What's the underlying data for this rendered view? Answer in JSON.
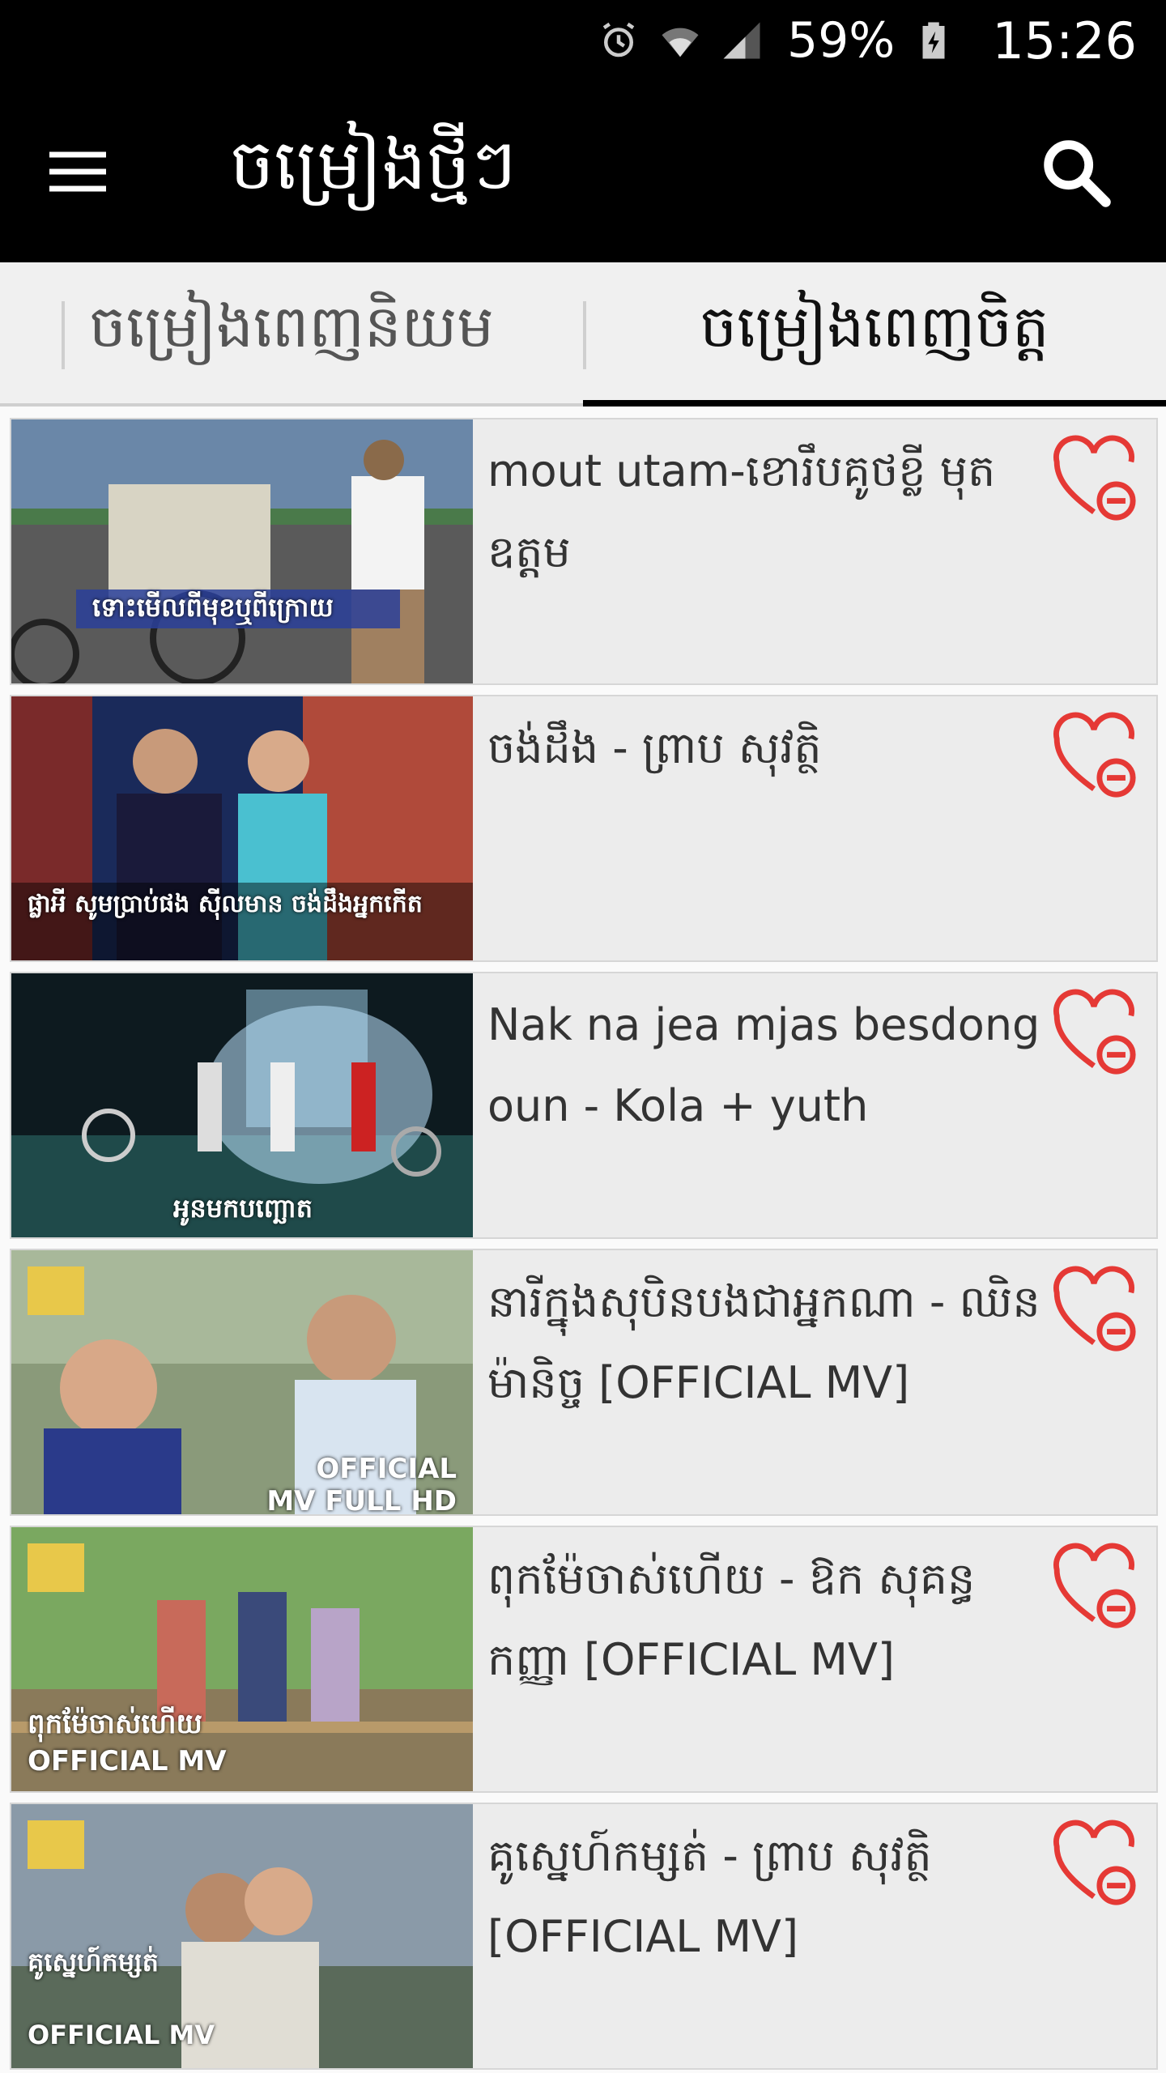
{
  "status_bar": {
    "icons": [
      "alarm-icon",
      "wifi-icon",
      "signal-icon",
      "battery-icon"
    ],
    "battery": "59%",
    "time": "15:26"
  },
  "app_bar": {
    "title": "ចម្រៀងថ្មីៗ",
    "menu_icon": "hamburger-menu-icon",
    "search_icon": "search-icon"
  },
  "tabs": [
    {
      "label": "ចម្រៀងពេញនិយម",
      "active": false
    },
    {
      "label": "ចម្រៀងពេញចិត្ត",
      "active": true
    }
  ],
  "songs": [
    {
      "title": "mout utam-ខោរឹបគូថខ្លី មុត ឧត្តម",
      "thumb_caption": "ទោះមើលពីមុខឬពីក្រោយ",
      "favorite_icon": "heart-minus-icon"
    },
    {
      "title": "ចង់ដឹង - ព្រាប សុវត្ថិ",
      "thumb_caption": "ផ្លាអី សូមប្រាប់ផង ស៊ីលមាន ចង់ដឹងអ្នកកើត",
      "favorite_icon": "heart-minus-icon"
    },
    {
      "title": "Nak na jea mjas besdong oun - Kola + yuth",
      "thumb_caption": "អូនមកបញ្ឆោត",
      "favorite_icon": "heart-minus-icon"
    },
    {
      "title": "នារីក្នុងសុបិនបងជាអ្នកណា - ឈិន ម៉ានិច្ច [OFFICIAL MV]",
      "thumb_caption": "OFFICIAL MV FULL HD",
      "favorite_icon": "heart-minus-icon"
    },
    {
      "title": "ពុកម៉ែចាស់ហើយ - ឱក សុគន្ធកញ្ញា [OFFICIAL MV]",
      "thumb_caption": "ពុកម៉ែចាស់ហើយ OFFICIAL MV",
      "favorite_icon": "heart-minus-icon"
    },
    {
      "title": "គូស្នេហ៍កម្សត់ - ព្រាប សុវត្ថិ [OFFICIAL MV]",
      "thumb_caption": "គូស្នេហ៍កម្សត់ OFFICIAL MV",
      "favorite_icon": "heart-minus-icon"
    }
  ],
  "colors": {
    "bar_bg": "#000000",
    "heart": "#e53935",
    "card_bg": "#ececec"
  }
}
